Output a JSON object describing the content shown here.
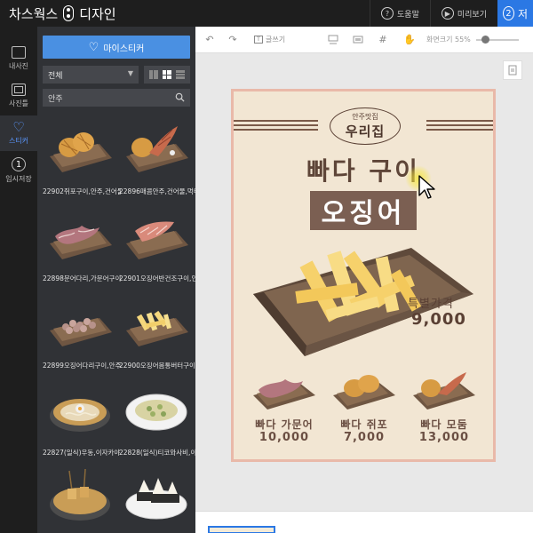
{
  "app": {
    "name_left": "차스웍스",
    "name_right": "디자인"
  },
  "topbar": {
    "help_label": "도움말",
    "preview_label": "미리보기",
    "step_number": "2",
    "step_label": "저"
  },
  "leftnav": {
    "items": [
      {
        "label": "내사진",
        "icon": "photo-frame-icon"
      },
      {
        "label": "사진틀",
        "icon": "frame-icon"
      },
      {
        "label": "스티커",
        "icon": "heart-icon"
      },
      {
        "label": "임시저장",
        "number": "1"
      }
    ]
  },
  "panel": {
    "my_sticker_label": "마이스티커",
    "category_value": "전체",
    "search_value": "안주",
    "stickers": [
      {
        "caption": "22902쥐포구이,안주,건어물"
      },
      {
        "caption": "22896매콤안주,건어물,먹태"
      },
      {
        "caption": "22898문어다리,가문어구이"
      },
      {
        "caption": "22901오징어반건조구이,안"
      },
      {
        "caption": "22899오징어다리구이,안주"
      },
      {
        "caption": "22900오징어몸통버터구이,"
      },
      {
        "caption": "22827(일식)우동,이자카야"
      },
      {
        "caption": "22828(일식)티코와사비,이"
      },
      {
        "caption": ""
      },
      {
        "caption": ""
      }
    ]
  },
  "toolbar": {
    "text_label": "글쓰기",
    "zoom_label": "화면크기 55%",
    "zoom_percent": 55
  },
  "poster": {
    "badge_small": "안주맛집",
    "badge_big": "우리집",
    "headline": "빠다 구이",
    "title": "오징어",
    "special_label": "특별가격",
    "special_price": "9,000",
    "menu": [
      {
        "name": "빠다 가문어",
        "price": "10,000"
      },
      {
        "name": "빠다 쥐포",
        "price": "7,000"
      },
      {
        "name": "빠다 모둠",
        "price": "13,000"
      }
    ]
  },
  "colors": {
    "accent": "#4a90e2",
    "primary_button": "#2b78e4",
    "panel_bg": "#303236",
    "nav_bg": "#1e1e1e",
    "poster_bg": "#f2e6d3",
    "poster_border": "#e9b9a9",
    "poster_text": "#5e4538"
  }
}
